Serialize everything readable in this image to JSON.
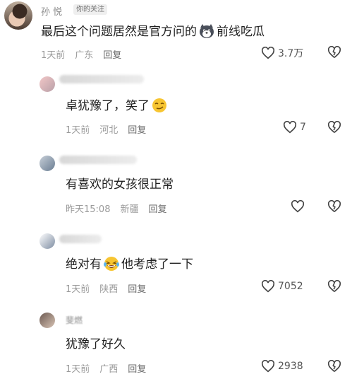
{
  "comments": [
    {
      "name": "孙 悦",
      "badge": "你的关注",
      "text_before": "最后这个问题居然是官方问的",
      "text_after": "前线吃瓜",
      "emoji": "dog-emoji",
      "time": "1天前",
      "location": "广东",
      "reply": "回复",
      "likes": "3.7万"
    },
    {
      "text_before": "卓犹豫了，笑了",
      "text_after": "",
      "emoji": "smirk-emoji",
      "time": "1天前",
      "location": "河北",
      "reply": "回复",
      "likes": "7"
    },
    {
      "text_before": "有喜欢的女孩很正常",
      "time": "昨天15:08",
      "location": "新疆",
      "reply": "回复",
      "likes": ""
    },
    {
      "text_before": "绝对有",
      "text_after": "他考虑了一下",
      "emoji": "laugh-tears-emoji",
      "time": "1天前",
      "location": "陕西",
      "reply": "回复",
      "likes": "7052"
    },
    {
      "name_partial": "斐燃",
      "text_before": "犹豫了好久",
      "time": "1天前",
      "location": "广西",
      "reply": "回复",
      "likes": "2938"
    }
  ]
}
